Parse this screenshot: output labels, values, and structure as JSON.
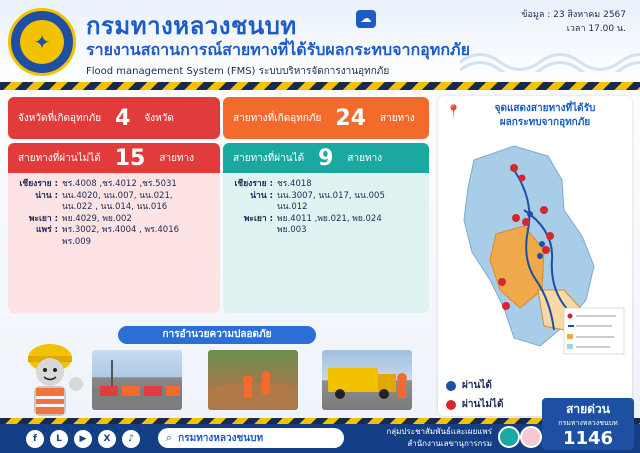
{
  "header": {
    "brand": "กรมทางหลวงชนบท",
    "title": "รายงานสถานการณ์สายทางที่ได้รับผลกระทบจากอุทกภัย",
    "subtitle": "Flood management System (FMS) ระบบบริหารจัดการงานอุทกภัย",
    "date_label": "ข้อมูล : 23 สิงหาคม 2567",
    "time_label": "เวลา 17.00 น."
  },
  "stats": {
    "provinces": {
      "label": "จังหวัดที่เกิดอุทกภัย",
      "value": "4",
      "unit": "จังหวัด"
    },
    "roads_affected": {
      "label": "สายทางที่เกิดอุทกภัย",
      "value": "24",
      "unit": "สายทาง"
    },
    "impassable": {
      "label": "สายทางที่ผ่านไม่ได้",
      "value": "15",
      "unit": "สายทาง",
      "rows": [
        {
          "province": "เชียงราย :",
          "roads": "ชร.4008 ,ชร.4012 ,ชร.5031"
        },
        {
          "province": "น่าน :",
          "roads": "นน.4020, นน.007, นน.021,"
        },
        {
          "province": "",
          "roads": "นน.022 , นน.014, นน.016"
        },
        {
          "province": "พะเยา :",
          "roads": "พย.4029, พย.002"
        },
        {
          "province": "แพร่ :",
          "roads": "พร.3002, พร.4004 , พร.4016"
        },
        {
          "province": "",
          "roads": "พร.009"
        }
      ]
    },
    "passable": {
      "label": "สายทางที่ผ่านได้",
      "value": "9",
      "unit": "สายทาง",
      "rows": [
        {
          "province": "เชียงราย :",
          "roads": "ชร.4018"
        },
        {
          "province": "น่าน :",
          "roads": "นน.3007, นน.017, นน.005"
        },
        {
          "province": "",
          "roads": "นน.012"
        },
        {
          "province": "พะเยา :",
          "roads": "พย.4011 ,พย.021, พย.024"
        },
        {
          "province": "",
          "roads": "พย.003"
        }
      ]
    }
  },
  "safety": {
    "title": "การอำนวยความปลอดภัย"
  },
  "map": {
    "title_line1": "จุดแสดงสายทางที่ได้รับ",
    "title_line2": "ผลกระทบจากอุทกภัย",
    "legend": [
      {
        "label": "ผ่านได้",
        "color": "#1d4fa3"
      },
      {
        "label": "ผ่านไม่ได้",
        "color": "#d6262e"
      }
    ]
  },
  "footer": {
    "search_text": "กรมทางหลวงชนบท",
    "org_line1": "กลุ่มประชาสัมพันธ์และเผยแพร่",
    "org_line2": "สำนักงานเลขานุการกรม",
    "hotline_label": "สายด่วน",
    "hotline_sub": "กรมทางหลวงชนบท",
    "hotline_number": "1146"
  },
  "colors": {
    "brand_blue": "#1d5cc6",
    "red": "#e23b3b",
    "orange": "#f26b2c",
    "teal": "#1aa8a0"
  },
  "icons": [
    "logo-seal",
    "rain-cloud-icon",
    "facebook-icon",
    "line-icon",
    "youtube-icon",
    "twitter-x-icon",
    "tiktok-icon",
    "search-icon"
  ]
}
